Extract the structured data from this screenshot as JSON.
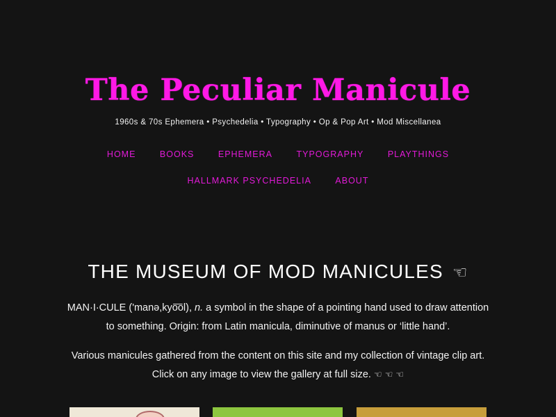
{
  "header": {
    "title": "The Peculiar Manicule",
    "tagline": "1960s & 70s Ephemera • Psychedelia • Typography • Op & Pop Art • Mod Miscellanea"
  },
  "nav": {
    "row1": [
      "HOME",
      "BOOKS",
      "EPHEMERA",
      "TYPOGRAPHY",
      "PLAYTHINGS"
    ],
    "row2": [
      "HALLMARK PSYCHEDELIA",
      "ABOUT"
    ]
  },
  "main": {
    "title": "THE MUSEUM OF MOD MANICULES",
    "title_icon": "☜",
    "definition_head": "MAN·I·CULE ('manə,kyo͞ol), ",
    "definition_pos": "n.",
    "definition_body": " a symbol in the shape of a pointing hand used to draw attention to something. Origin: from Latin manicula, diminutive of manus or ‘little hand’.",
    "intro": "Various manicules gathered from the content on this site and my collection of vintage clip art. Click on any image to view the gallery at full size.",
    "intro_icons": "☜ ☜ ☜"
  },
  "gallery": {
    "thumbnails": [
      {
        "color": "#efe8d8",
        "icon": "hand-illustration"
      },
      {
        "color": "#8dc63f",
        "icon": "hand-illustration"
      },
      {
        "color": "#c79e3b",
        "icon": "hand-illustration"
      }
    ]
  },
  "colors": {
    "background": "#141414",
    "accent": "#ff19e6",
    "nav_link": "#e31ad9",
    "text": "#f2f2f2"
  }
}
